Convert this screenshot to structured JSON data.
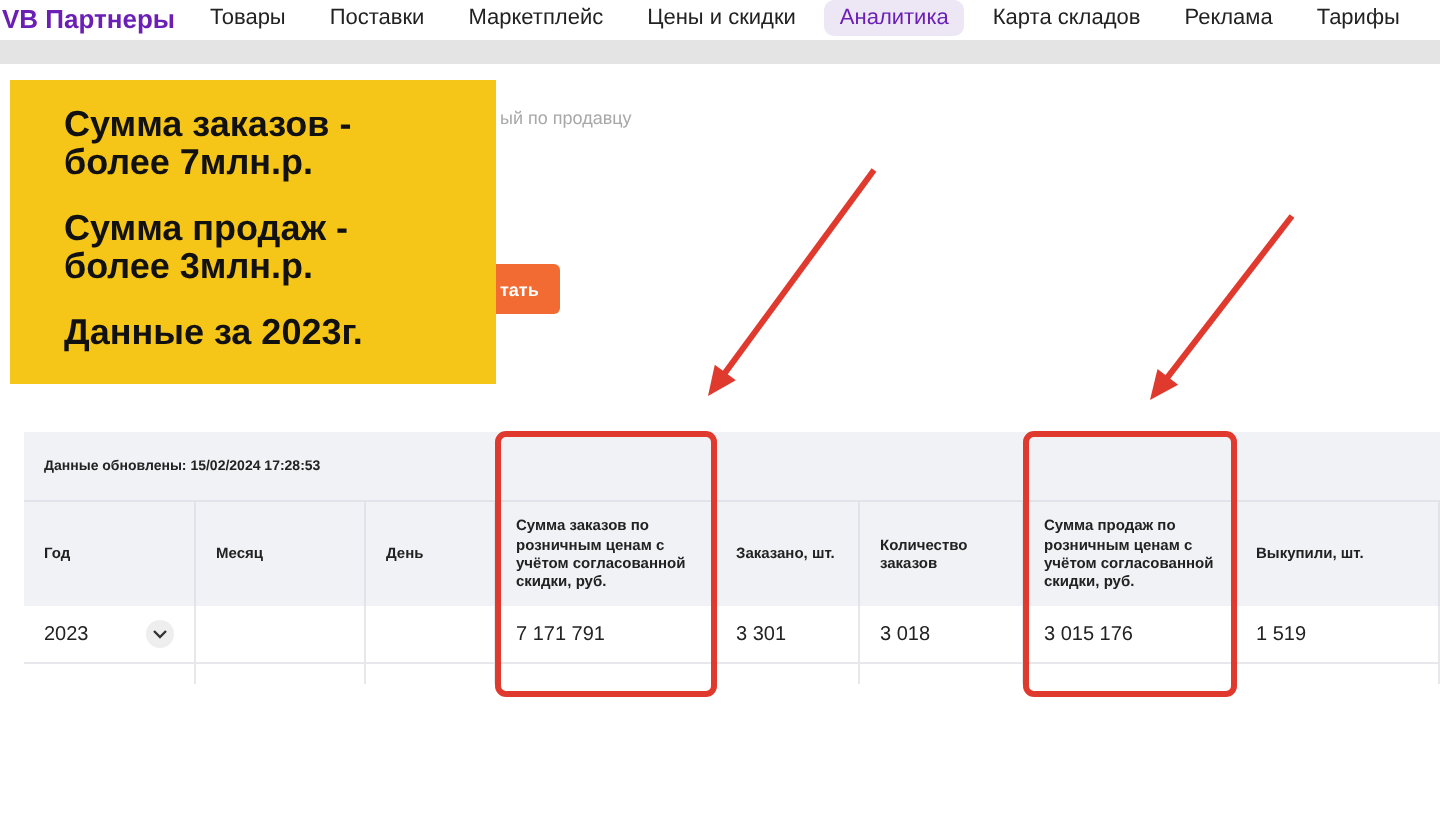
{
  "nav": {
    "brand": "VB Партнеры",
    "items": [
      {
        "label": "Товары",
        "selected": false
      },
      {
        "label": "Поставки",
        "selected": false
      },
      {
        "label": "Маркетплейс",
        "selected": false
      },
      {
        "label": "Цены и скидки",
        "selected": false
      },
      {
        "label": "Аналитика",
        "selected": true
      },
      {
        "label": "Карта складов",
        "selected": false
      },
      {
        "label": "Реклама",
        "selected": false
      },
      {
        "label": "Тарифы",
        "selected": false
      }
    ]
  },
  "filter_hint": "ый по продавцу",
  "action_button": "тать",
  "callout": {
    "lines": [
      "Сумма заказов - более 7млн.р.",
      "Сумма продаж - более 3млн.р.",
      "Данные за 2023г."
    ]
  },
  "table": {
    "updated": "Данные обновлены: 15/02/2024 17:28:53",
    "columns": [
      {
        "label": "Год",
        "highlighted": false
      },
      {
        "label": "Месяц",
        "highlighted": false
      },
      {
        "label": "День",
        "highlighted": false
      },
      {
        "label": "Сумма заказов по розничным ценам с учётом согласованной скидки, руб.",
        "highlighted": true
      },
      {
        "label": "Заказано, шт.",
        "highlighted": false
      },
      {
        "label": "Количество заказов",
        "highlighted": false
      },
      {
        "label": "Сумма продаж по розничным ценам с учётом согласованной скидки, руб.",
        "highlighted": true
      },
      {
        "label": "Выкупили, шт.",
        "highlighted": false
      }
    ],
    "rows": [
      {
        "cells": [
          "2023",
          "",
          "",
          "7 171 791",
          "3 301",
          "3 018",
          "3 015 176",
          "1 519"
        ],
        "expanded": false
      }
    ]
  }
}
